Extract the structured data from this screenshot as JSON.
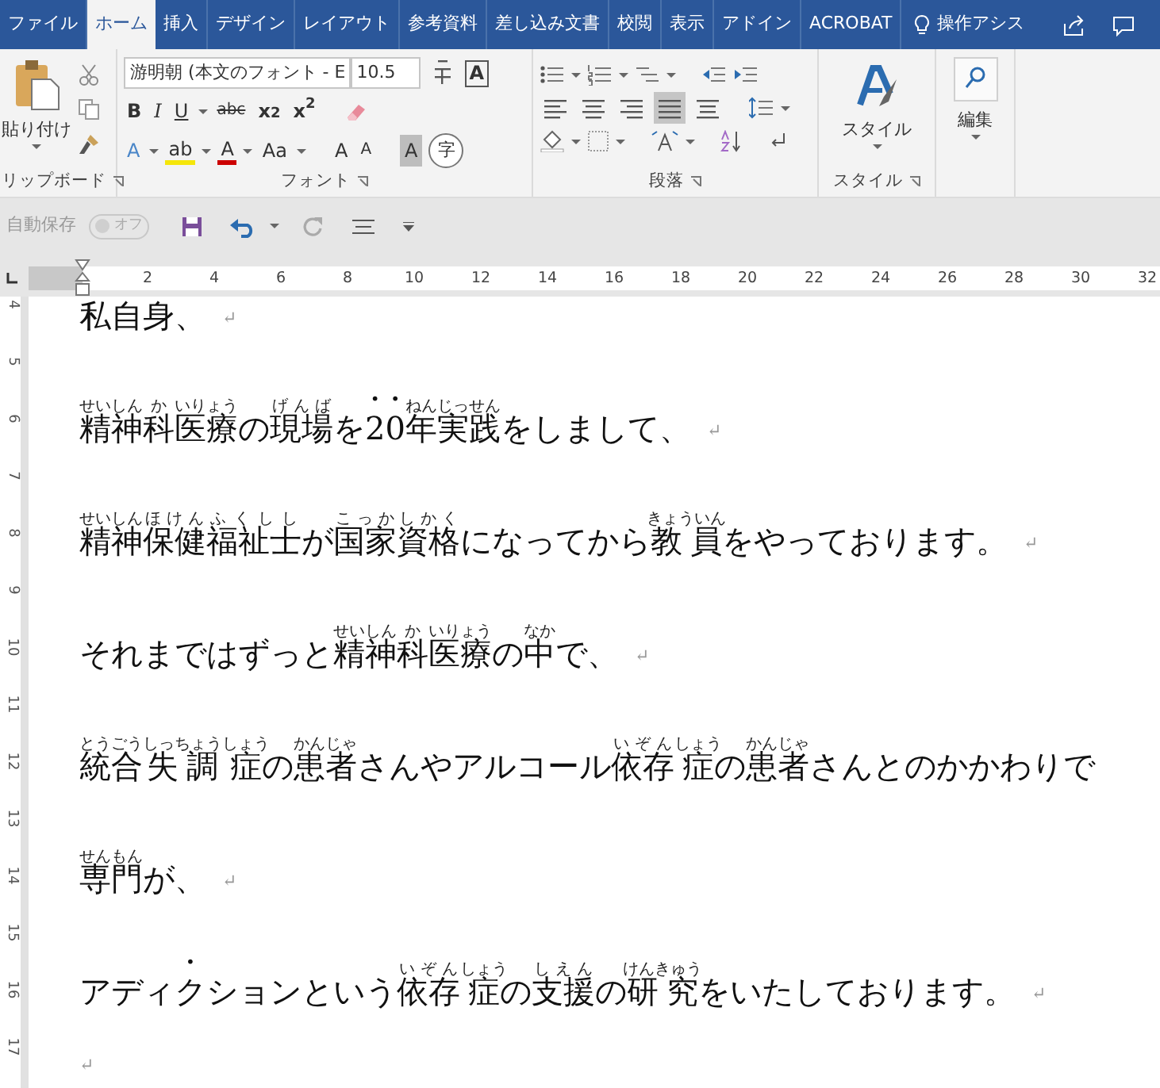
{
  "tabs": [
    {
      "label": "ファイル",
      "selected": false
    },
    {
      "label": "ホーム",
      "selected": true
    },
    {
      "label": "挿入",
      "selected": false
    },
    {
      "label": "デザイン",
      "selected": false
    },
    {
      "label": "レイアウト",
      "selected": false
    },
    {
      "label": "参考資料",
      "selected": false
    },
    {
      "label": "差し込み文書",
      "selected": false
    },
    {
      "label": "校閲",
      "selected": false
    },
    {
      "label": "表示",
      "selected": false
    },
    {
      "label": "アドイン",
      "selected": false
    },
    {
      "label": "ACROBAT",
      "selected": false
    }
  ],
  "tell_me": "操作アシス",
  "clipboard": {
    "paste_label": "貼り付け",
    "group_label": "リップボード"
  },
  "font": {
    "font_name": "游明朝 (本文のフォント - E",
    "font_size": "10.5",
    "box_letter": "A",
    "format_buttons": [
      "B",
      "I",
      "U",
      "abc",
      "x$_{2}$",
      "x$^{2}$"
    ],
    "effect_buttons": [
      "A",
      "ab",
      "A",
      "Aa",
      "A",
      "A",
      "A",
      "字"
    ],
    "group_label": "フォント"
  },
  "paragraph": {
    "align": [
      {
        "selected": false
      },
      {
        "selected": false
      },
      {
        "selected": false
      },
      {
        "selected": true
      },
      {
        "selected": false
      }
    ],
    "group_label": "段落"
  },
  "styles": {
    "button_label": "スタイル",
    "group_label": "スタイル"
  },
  "editing": {
    "button_label": "編集"
  },
  "quick_access": {
    "autosave_label": "自動保存",
    "autosave_on": false,
    "toggle_text": "オフ"
  },
  "ruler": {
    "numbers": [
      "2",
      "4",
      "6",
      "8",
      "10",
      "12",
      "14",
      "16",
      "18",
      "20",
      "22",
      "24",
      "26",
      "28",
      "30",
      "32"
    ]
  },
  "vertical_ruler": {
    "numbers": [
      "4",
      "5",
      "6",
      "7",
      "8",
      "9",
      "10",
      "11",
      "12",
      "13",
      "14",
      "15",
      "16",
      "17"
    ]
  },
  "document": {
    "paragraphs": [
      {
        "segments": [
          {
            "text": "私自身、"
          }
        ],
        "mark": "↵"
      },
      {
        "segments": [
          {
            "text": "精神",
            "ruby": "せいしん"
          },
          {
            "text": "科",
            "ruby": "か"
          },
          {
            "text": "医療",
            "ruby": "いりょう"
          },
          {
            "text": "の"
          },
          {
            "text": "現場",
            "ruby": "げんば"
          },
          {
            "text": "を"
          },
          {
            "text": "20",
            "emphasis": true
          },
          {
            "text": "年",
            "ruby": "ねん"
          },
          {
            "text": "実践",
            "ruby": "じっせん"
          },
          {
            "text": "をしまして、"
          }
        ],
        "mark": "↵"
      },
      {
        "segments": [
          {
            "text": "精神",
            "ruby": "せいしん"
          },
          {
            "text": "保健",
            "ruby": "ほけん"
          },
          {
            "text": "福祉士",
            "ruby": "ふくしし"
          },
          {
            "text": "が"
          },
          {
            "text": "国家",
            "ruby": "こっか"
          },
          {
            "text": "資格",
            "ruby": "しかく"
          },
          {
            "text": "になってから"
          },
          {
            "text": "教員",
            "ruby": "きょういん"
          },
          {
            "text": "をやっております。"
          }
        ],
        "mark": "↵"
      },
      {
        "segments": [
          {
            "text": "それまではずっと"
          },
          {
            "text": "精神",
            "ruby": "せいしん"
          },
          {
            "text": "科",
            "ruby": "か"
          },
          {
            "text": "医療",
            "ruby": "いりょう"
          },
          {
            "text": "の"
          },
          {
            "text": "中",
            "ruby": "なか"
          },
          {
            "text": "で、"
          }
        ],
        "mark": "↵"
      },
      {
        "segments": [
          {
            "text": "統合",
            "ruby": "とうごう"
          },
          {
            "text": "失調",
            "ruby": "しっちょう"
          },
          {
            "text": "症",
            "ruby": "しょう"
          },
          {
            "text": "の"
          },
          {
            "text": "患者",
            "ruby": "かんじゃ"
          },
          {
            "text": "さんやアルコール"
          },
          {
            "text": "依存",
            "ruby": "いぞん"
          },
          {
            "text": "症",
            "ruby": "しょう"
          },
          {
            "text": "の"
          },
          {
            "text": "患者",
            "ruby": "かんじゃ"
          },
          {
            "text": "さんとのかかわりで"
          }
        ]
      },
      {
        "segments": [
          {
            "text": "専門",
            "ruby": "せんもん"
          },
          {
            "text": "が、"
          }
        ],
        "mark": "↵"
      },
      {
        "segments": [
          {
            "text": "アディ"
          },
          {
            "text": "ク",
            "emphasis": true
          },
          {
            "text": "ションという"
          },
          {
            "text": "依存",
            "ruby": "いぞん"
          },
          {
            "text": "症",
            "ruby": "しょう"
          },
          {
            "text": "の"
          },
          {
            "text": "支援",
            "ruby": "しえん"
          },
          {
            "text": "の"
          },
          {
            "text": "研究",
            "ruby": "けんきゅう"
          },
          {
            "text": "をいたしております。"
          }
        ],
        "mark": "↵"
      },
      {
        "mark": "↵"
      }
    ]
  }
}
